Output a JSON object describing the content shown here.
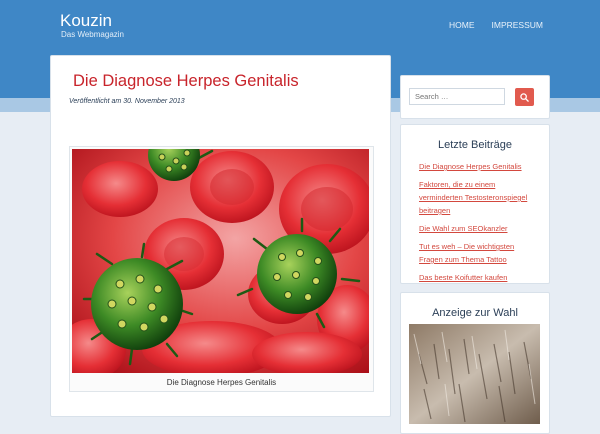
{
  "site": {
    "title": "Kouzin",
    "tagline": "Das Webmagazin"
  },
  "nav": {
    "items": [
      {
        "label": "HOME"
      },
      {
        "label": "IMPRESSUM"
      }
    ]
  },
  "post": {
    "title": "Die Diagnose Herpes Genitalis",
    "meta": "Veröffentlicht am 30. November 2013",
    "image_caption": "Die Diagnose Herpes Genitalis"
  },
  "sidebar": {
    "search": {
      "placeholder": "Search …",
      "button_icon": "search-icon"
    },
    "recent_posts": {
      "title": "Letzte Beiträge",
      "items": [
        {
          "label": "Die Diagnose Herpes Genitalis"
        },
        {
          "label": "Faktoren, die zu einem verminderten Testosteronspiegel beitragen"
        },
        {
          "label": "Die Wahl zum SEOkanzler"
        },
        {
          "label": "Tut es weh – Die wichtigsten Fragen zum Thema Tattoo"
        },
        {
          "label": "Das beste Koifutter kaufen"
        }
      ]
    },
    "ad": {
      "title": "Anzeige zur Wahl"
    }
  },
  "colors": {
    "header": "#3f87c6",
    "accent_red": "#c8242b",
    "link": "#d3483e",
    "search_button": "#e15a4e"
  }
}
